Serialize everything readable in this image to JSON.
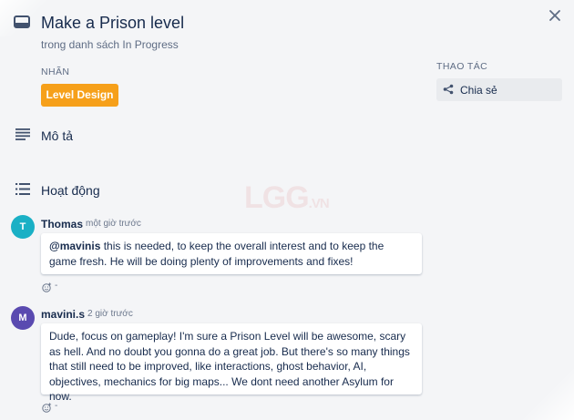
{
  "card": {
    "title": "Make a Prison level",
    "list_text": "trong danh sách In Progress"
  },
  "labels": {
    "heading": "NHÃN",
    "items": [
      {
        "text": "Level Design",
        "color": "#f6a01a"
      }
    ]
  },
  "actions": {
    "heading": "THAO TÁC",
    "share_label": "Chia sẻ"
  },
  "description": {
    "heading": "Mô tả"
  },
  "activity": {
    "heading": "Hoạt động",
    "comments": [
      {
        "initial": "T",
        "avatar_color": "#1ab0c5",
        "author": "Thomas",
        "time": "một giờ trước",
        "mention": "@mavinis",
        "text": " this is needed, to keep the overall interest and to keep the game fresh. He will be doing plenty of improvements and fixes!",
        "footer": "-"
      },
      {
        "initial": "M",
        "avatar_color": "#5a4ab0",
        "author": "mavini.s",
        "time": "2 giờ trước",
        "text": "Dude, focus on gameplay! I'm sure a Prison Level will be awesome, scary as hell. And no doubt you gonna do a great job. But there's so many things that still need to be improved, like interactions, ghost behavior, AI, objectives, mechanics for big maps... We dont need another Asylum for now.",
        "footer": "-"
      }
    ]
  },
  "watermark": {
    "main": "LGG",
    "suffix": ".VN"
  },
  "icons": {
    "card": "card-icon",
    "close": "close-icon",
    "share": "share-icon",
    "description": "description-icon",
    "activity": "activity-icon",
    "reaction": "add-reaction-icon"
  }
}
